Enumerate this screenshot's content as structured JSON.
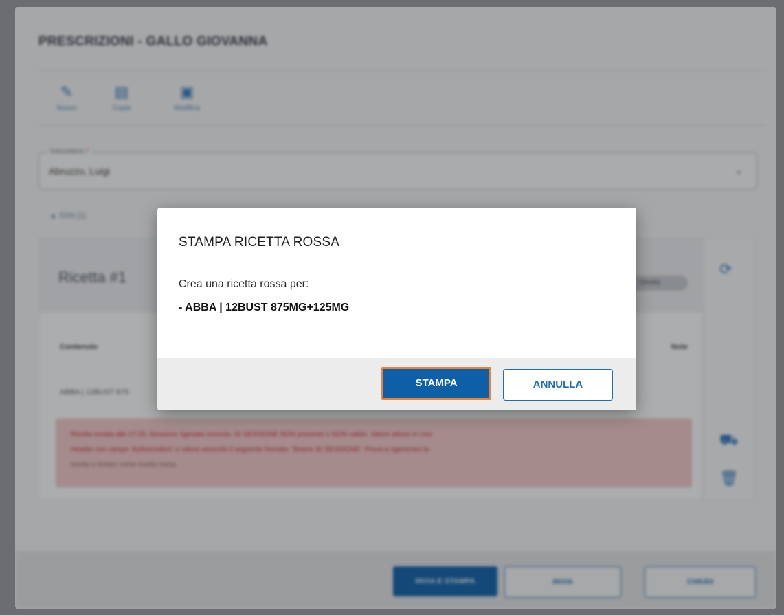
{
  "main": {
    "title": "PRESCRIZIONI - GALLO GIOVANNA",
    "toolbar": [
      {
        "label": "Nuovo",
        "icon": "pencil-icon"
      },
      {
        "label": "Copia",
        "icon": "document-icon"
      },
      {
        "label": "Modifica",
        "icon": "clipboard-icon"
      }
    ],
    "select": {
      "legend": "Intestatario",
      "required_mark": "*",
      "value": "Abruzzo, Luigi"
    },
    "sub_toggle": "SSN (1)",
    "card": {
      "title": "Ricetta #1",
      "pill": "Diretta",
      "col_left": "Contenuto",
      "col_right": "Note",
      "row_text": "ABBA | 12BUST 875",
      "error_lines": [
        "Ricetta inviata alle 17:20, Sessione rigenata ricevuta: ID SESSIONE NON presente o NON valido. Valore atteso in Uso",
        "Header con campo 'Authorization' o valore secondo il seguente formato: 'Bearer ID SESSIONE'. Prova a rigenerare la",
        "ricetta o inviare come ricetta rossa."
      ]
    },
    "footer": {
      "save_print": "INVIA E STAMPA",
      "save": "INVIA",
      "close": "CHIUDI"
    }
  },
  "dialog": {
    "title": "STAMPA RICETTA ROSSA",
    "text": "Crea una ricetta rossa per:",
    "item": "- ABBA | 12BUST 875MG+125MG",
    "confirm_label": "STAMPA",
    "cancel_label": "ANNULLA"
  },
  "colors": {
    "primary": "#0d5fa8",
    "focus_outline": "#e8813a",
    "error_text": "#c6353b",
    "error_bg": "#ecc7c9"
  }
}
